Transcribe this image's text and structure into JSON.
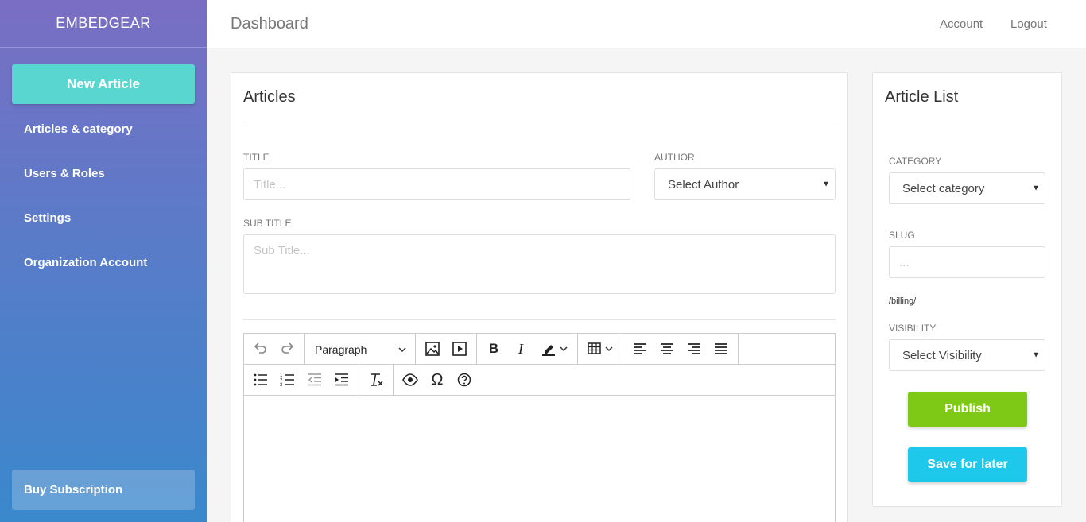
{
  "sidebar": {
    "brand": "EMBEDGEAR",
    "new_article": "New Article",
    "items": [
      {
        "label": "Articles & category"
      },
      {
        "label": "Users & Roles"
      },
      {
        "label": "Settings"
      },
      {
        "label": "Organization Account"
      }
    ],
    "buy_subscription": "Buy Subscription"
  },
  "header": {
    "title": "Dashboard",
    "account": "Account",
    "logout": "Logout"
  },
  "articles": {
    "title": "Articles",
    "title_label": "TITLE",
    "title_placeholder": "Title...",
    "author_label": "AUTHOR",
    "author_value": "Select Author",
    "subtitle_label": "SUB TITLE",
    "subtitle_placeholder": "Sub Title...",
    "editor": {
      "paragraph_select": "Paragraph",
      "icons": [
        "undo-icon",
        "redo-icon",
        "image-icon",
        "video-icon",
        "bold-icon",
        "italic-icon",
        "highlight-icon",
        "table-icon",
        "align-left-icon",
        "align-center-icon",
        "align-right-icon",
        "align-justify-icon",
        "bullet-list-icon",
        "numbered-list-icon",
        "outdent-icon",
        "indent-icon",
        "clear-format-icon",
        "preview-icon",
        "special-char-icon",
        "help-icon"
      ]
    }
  },
  "article_list": {
    "title": "Article List",
    "category_label": "CATEGORY",
    "category_value": "Select category",
    "slug_label": "SLUG",
    "slug_placeholder": "...",
    "slug_path": "/billing/",
    "visibility_label": "VISIBILITY",
    "visibility_value": "Select Visibility",
    "publish": "Publish",
    "save_for_later": "Save for later"
  },
  "colors": {
    "new_article": "#5ad6d0",
    "publish": "#7ec915",
    "save": "#1ec8ea"
  }
}
